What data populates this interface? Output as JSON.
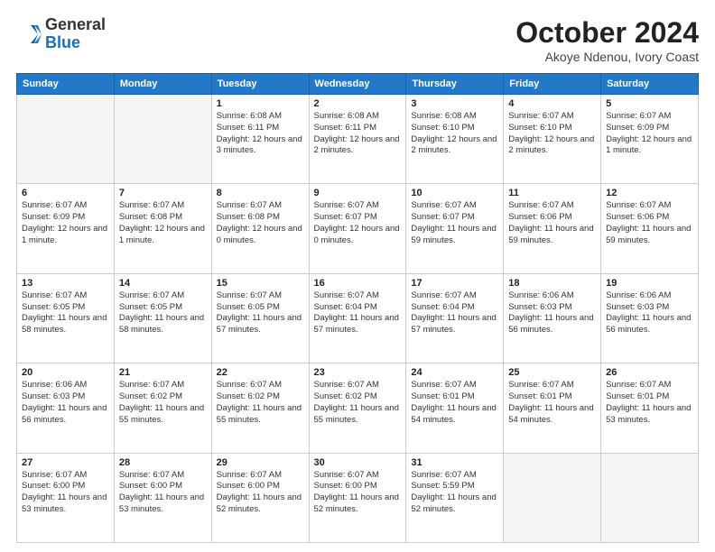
{
  "header": {
    "logo": {
      "general": "General",
      "blue": "Blue"
    },
    "title": "October 2024",
    "location": "Akoye Ndenou, Ivory Coast"
  },
  "calendar": {
    "headers": [
      "Sunday",
      "Monday",
      "Tuesday",
      "Wednesday",
      "Thursday",
      "Friday",
      "Saturday"
    ],
    "weeks": [
      [
        {
          "day": "",
          "info": ""
        },
        {
          "day": "",
          "info": ""
        },
        {
          "day": "1",
          "info": "Sunrise: 6:08 AM\nSunset: 6:11 PM\nDaylight: 12 hours\nand 3 minutes."
        },
        {
          "day": "2",
          "info": "Sunrise: 6:08 AM\nSunset: 6:11 PM\nDaylight: 12 hours\nand 2 minutes."
        },
        {
          "day": "3",
          "info": "Sunrise: 6:08 AM\nSunset: 6:10 PM\nDaylight: 12 hours\nand 2 minutes."
        },
        {
          "day": "4",
          "info": "Sunrise: 6:07 AM\nSunset: 6:10 PM\nDaylight: 12 hours\nand 2 minutes."
        },
        {
          "day": "5",
          "info": "Sunrise: 6:07 AM\nSunset: 6:09 PM\nDaylight: 12 hours\nand 1 minute."
        }
      ],
      [
        {
          "day": "6",
          "info": "Sunrise: 6:07 AM\nSunset: 6:09 PM\nDaylight: 12 hours\nand 1 minute."
        },
        {
          "day": "7",
          "info": "Sunrise: 6:07 AM\nSunset: 6:08 PM\nDaylight: 12 hours\nand 1 minute."
        },
        {
          "day": "8",
          "info": "Sunrise: 6:07 AM\nSunset: 6:08 PM\nDaylight: 12 hours\nand 0 minutes."
        },
        {
          "day": "9",
          "info": "Sunrise: 6:07 AM\nSunset: 6:07 PM\nDaylight: 12 hours\nand 0 minutes."
        },
        {
          "day": "10",
          "info": "Sunrise: 6:07 AM\nSunset: 6:07 PM\nDaylight: 11 hours\nand 59 minutes."
        },
        {
          "day": "11",
          "info": "Sunrise: 6:07 AM\nSunset: 6:06 PM\nDaylight: 11 hours\nand 59 minutes."
        },
        {
          "day": "12",
          "info": "Sunrise: 6:07 AM\nSunset: 6:06 PM\nDaylight: 11 hours\nand 59 minutes."
        }
      ],
      [
        {
          "day": "13",
          "info": "Sunrise: 6:07 AM\nSunset: 6:05 PM\nDaylight: 11 hours\nand 58 minutes."
        },
        {
          "day": "14",
          "info": "Sunrise: 6:07 AM\nSunset: 6:05 PM\nDaylight: 11 hours\nand 58 minutes."
        },
        {
          "day": "15",
          "info": "Sunrise: 6:07 AM\nSunset: 6:05 PM\nDaylight: 11 hours\nand 57 minutes."
        },
        {
          "day": "16",
          "info": "Sunrise: 6:07 AM\nSunset: 6:04 PM\nDaylight: 11 hours\nand 57 minutes."
        },
        {
          "day": "17",
          "info": "Sunrise: 6:07 AM\nSunset: 6:04 PM\nDaylight: 11 hours\nand 57 minutes."
        },
        {
          "day": "18",
          "info": "Sunrise: 6:06 AM\nSunset: 6:03 PM\nDaylight: 11 hours\nand 56 minutes."
        },
        {
          "day": "19",
          "info": "Sunrise: 6:06 AM\nSunset: 6:03 PM\nDaylight: 11 hours\nand 56 minutes."
        }
      ],
      [
        {
          "day": "20",
          "info": "Sunrise: 6:06 AM\nSunset: 6:03 PM\nDaylight: 11 hours\nand 56 minutes."
        },
        {
          "day": "21",
          "info": "Sunrise: 6:07 AM\nSunset: 6:02 PM\nDaylight: 11 hours\nand 55 minutes."
        },
        {
          "day": "22",
          "info": "Sunrise: 6:07 AM\nSunset: 6:02 PM\nDaylight: 11 hours\nand 55 minutes."
        },
        {
          "day": "23",
          "info": "Sunrise: 6:07 AM\nSunset: 6:02 PM\nDaylight: 11 hours\nand 55 minutes."
        },
        {
          "day": "24",
          "info": "Sunrise: 6:07 AM\nSunset: 6:01 PM\nDaylight: 11 hours\nand 54 minutes."
        },
        {
          "day": "25",
          "info": "Sunrise: 6:07 AM\nSunset: 6:01 PM\nDaylight: 11 hours\nand 54 minutes."
        },
        {
          "day": "26",
          "info": "Sunrise: 6:07 AM\nSunset: 6:01 PM\nDaylight: 11 hours\nand 53 minutes."
        }
      ],
      [
        {
          "day": "27",
          "info": "Sunrise: 6:07 AM\nSunset: 6:00 PM\nDaylight: 11 hours\nand 53 minutes."
        },
        {
          "day": "28",
          "info": "Sunrise: 6:07 AM\nSunset: 6:00 PM\nDaylight: 11 hours\nand 53 minutes."
        },
        {
          "day": "29",
          "info": "Sunrise: 6:07 AM\nSunset: 6:00 PM\nDaylight: 11 hours\nand 52 minutes."
        },
        {
          "day": "30",
          "info": "Sunrise: 6:07 AM\nSunset: 6:00 PM\nDaylight: 11 hours\nand 52 minutes."
        },
        {
          "day": "31",
          "info": "Sunrise: 6:07 AM\nSunset: 5:59 PM\nDaylight: 11 hours\nand 52 minutes."
        },
        {
          "day": "",
          "info": ""
        },
        {
          "day": "",
          "info": ""
        }
      ]
    ]
  }
}
